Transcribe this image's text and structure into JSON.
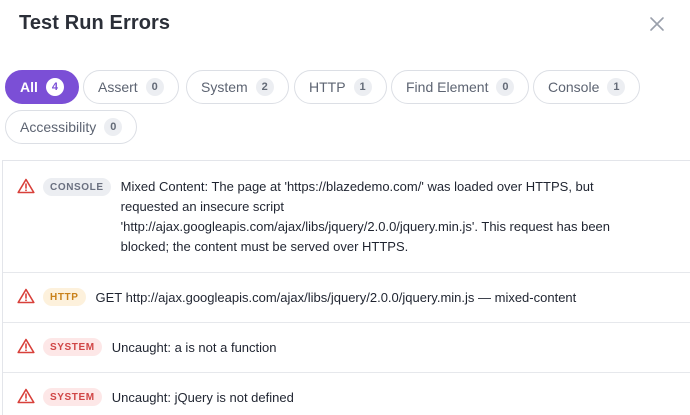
{
  "dialog": {
    "title": "Test Run Errors",
    "close_icon": "close-icon"
  },
  "filters": [
    {
      "label": "All",
      "count": "4",
      "active": true
    },
    {
      "label": "Assert",
      "count": "0",
      "active": false
    },
    {
      "label": "System",
      "count": "2",
      "active": false
    },
    {
      "label": "HTTP",
      "count": "1",
      "active": false
    },
    {
      "label": "Find Element",
      "count": "0",
      "active": false
    },
    {
      "label": "Console",
      "count": "1",
      "active": false
    },
    {
      "label": "Accessibility",
      "count": "0",
      "active": false
    }
  ],
  "errors": [
    {
      "type": "CONSOLE",
      "message": "Mixed Content: The page at 'https://blazedemo.com/' was loaded over HTTPS, but requested an insecure script 'http://ajax.googleapis.com/ajax/libs/jquery/2.0.0/jquery.min.js'. This request has been blocked; the content must be served over HTTPS."
    },
    {
      "type": "HTTP",
      "message": "GET http://ajax.googleapis.com/ajax/libs/jquery/2.0.0/jquery.min.js — mixed-content"
    },
    {
      "type": "SYSTEM",
      "message": "Uncaught: a is not a function"
    },
    {
      "type": "SYSTEM",
      "message": "Uncaught: jQuery is not defined"
    }
  ],
  "colors": {
    "accent": "#7b4fd6",
    "warning_icon": "#d8403a",
    "http_badge": "#c9811a",
    "system_badge": "#d04545"
  }
}
